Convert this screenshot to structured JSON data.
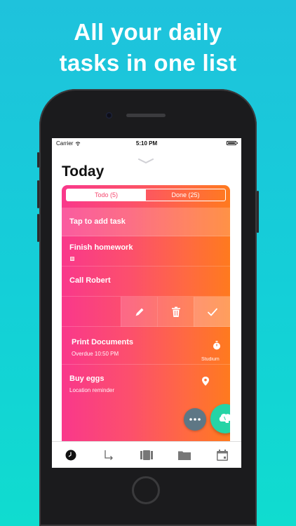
{
  "headline": {
    "line1": "All your daily",
    "line2": "tasks in one list"
  },
  "status_bar": {
    "carrier": "Carrier",
    "time": "5:10 PM"
  },
  "screen_title": "Today",
  "segments": {
    "todo": "Todo (5)",
    "done": "Done (25)"
  },
  "add_task_placeholder": "Tap to add task",
  "tasks": [
    {
      "title": "Finish homework",
      "subtitle": "",
      "has_note_icon": true
    },
    {
      "title": "Call Robert",
      "subtitle": ""
    },
    {
      "title": "Print Documents",
      "subtitle": "Overdue 10:50 PM",
      "badge": "Studium",
      "icon": "timer-icon"
    },
    {
      "title": "Buy eggs",
      "subtitle": "Location reminder",
      "icon": "location-pin-icon"
    }
  ],
  "swipe_actions": [
    "edit-icon",
    "trash-icon",
    "check-icon"
  ],
  "tab_bar": [
    "clock-icon",
    "arrow-return-icon",
    "board-icon",
    "folder-icon",
    "calendar-icon"
  ],
  "colors": {
    "accent_pink": "#f9388b",
    "accent_orange": "#ff7a1e",
    "fab_green": "#25d4a6",
    "fab_gray": "#5e7785",
    "background": "#1fc2dc"
  }
}
